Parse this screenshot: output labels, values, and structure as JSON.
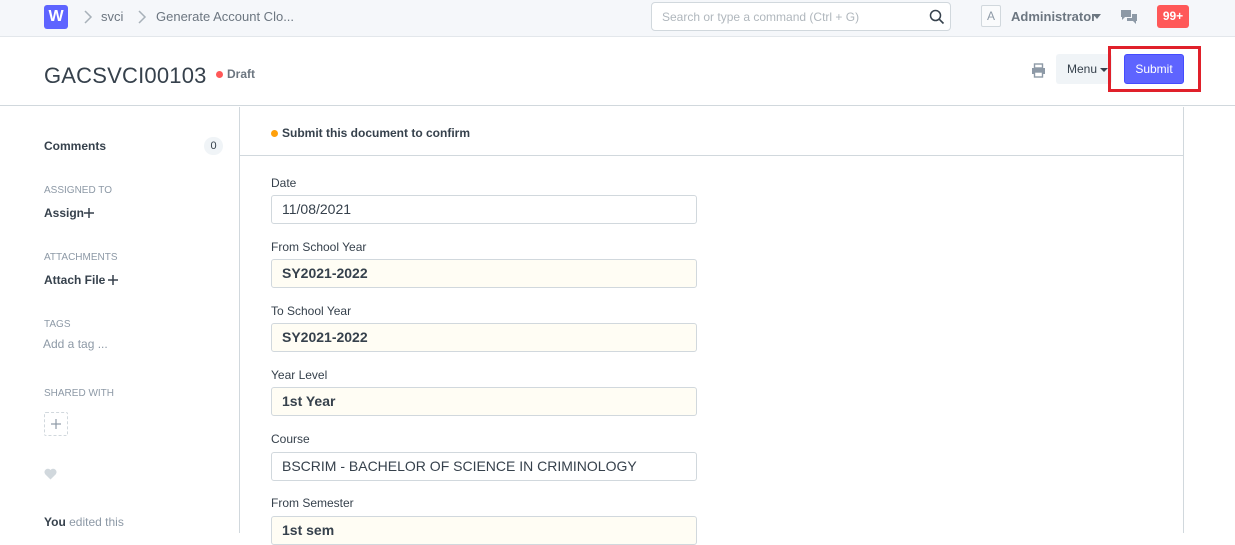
{
  "navbar": {
    "logo": "W",
    "breadcrumbs": [
      "svci",
      "Generate Account Clo..."
    ],
    "search_placeholder": "Search or type a command (Ctrl + G)",
    "avatar_letter": "A",
    "user_name": "Administrator",
    "notification_count": "99+"
  },
  "page_head": {
    "title": "GACSVCI00103",
    "status": "Draft",
    "status_color": "#ff5858",
    "menu_label": "Menu",
    "submit_label": "Submit",
    "primary_color": "#5e64ff"
  },
  "sidebar": {
    "comments_label": "Comments",
    "comments_count": "0",
    "assigned_to_label": "ASSIGNED TO",
    "assign_label": "Assign",
    "attachments_label": "ATTACHMENTS",
    "attach_label": "Attach File",
    "tags_label": "TAGS",
    "tag_placeholder": "Add a tag ...",
    "shared_with_label": "SHARED WITH",
    "activity_user": "You",
    "activity_text": "edited this"
  },
  "form": {
    "message": "Submit this document to confirm",
    "fields": [
      {
        "label": "Date",
        "value": "11/08/2021"
      },
      {
        "label": "From School Year",
        "value": "SY2021-2022"
      },
      {
        "label": "To School Year",
        "value": "SY2021-2022"
      },
      {
        "label": "Year Level",
        "value": "1st Year"
      },
      {
        "label": "Course",
        "value": "BSCRIM - BACHELOR OF SCIENCE IN CRIMINOLOGY"
      },
      {
        "label": "From Semester",
        "value": "1st sem"
      }
    ]
  }
}
